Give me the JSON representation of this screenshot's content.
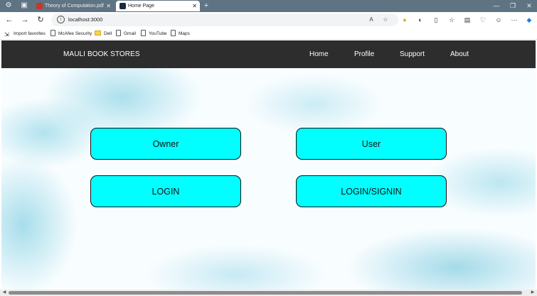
{
  "browser": {
    "tabs": [
      {
        "title": "Theory of Computation.pdf",
        "favicon_color": "#c0392b",
        "active": false
      },
      {
        "title": "Home Page",
        "favicon_color": "#1b2b3a",
        "active": true
      }
    ],
    "new_tab_icon": "plus-icon",
    "address": {
      "url": "localhost:3000"
    },
    "bookmarks": [
      {
        "label": "Import favorites",
        "icon": "import-icon"
      },
      {
        "label": "McAfee Security",
        "icon": "page-icon"
      },
      {
        "label": "Dell",
        "icon": "folder-icon"
      },
      {
        "label": "Gmail",
        "icon": "page-icon"
      },
      {
        "label": "YouTube",
        "icon": "page-icon"
      },
      {
        "label": "Maps",
        "icon": "page-icon"
      }
    ],
    "colors": {
      "tabbar": "#5f7482"
    }
  },
  "site": {
    "brand": "MAULI BOOK STORES",
    "nav": [
      "Home",
      "Profile",
      "Support",
      "About"
    ],
    "cards": {
      "owner": "Owner",
      "user": "User",
      "login": "LOGIN",
      "login_signin": "LOGIN/SIGNIN"
    },
    "colors": {
      "navbar": "#2d2d2d",
      "card": "#00ffff"
    }
  }
}
